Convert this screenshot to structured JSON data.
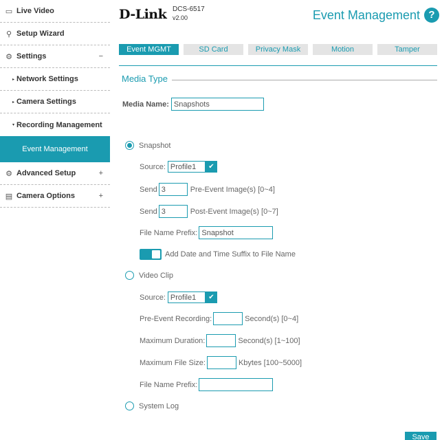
{
  "sidebar": {
    "live_video": "Live Video",
    "setup_wizard": "Setup Wizard",
    "settings": "Settings",
    "settings_toggle": "−",
    "network_settings": "Network Settings",
    "camera_settings": "Camera Settings",
    "recording_management": "Recording Management",
    "event_management": "Event Management",
    "advanced_setup": "Advanced Setup",
    "advanced_toggle": "+",
    "camera_options": "Camera Options",
    "camera_toggle": "+"
  },
  "header": {
    "logo": "D-Link",
    "model": "DCS-6517",
    "version": "v2.00",
    "title": "Event Management",
    "help": "?"
  },
  "tabs": [
    "Event MGMT",
    "SD Card",
    "Privacy Mask",
    "Motion",
    "Tamper"
  ],
  "section": {
    "title": "Media Type"
  },
  "form": {
    "media_name_label": "Media Name:",
    "media_name_value": "Snapshots",
    "snapshot_label": "Snapshot",
    "source_label": "Source:",
    "source_value": "Profile1",
    "send_label": "Send",
    "pre_count": "3",
    "pre_label": "Pre-Event Image(s) [0~4]",
    "post_count": "3",
    "post_label": "Post-Event Image(s) [0~7]",
    "prefix_label": "File Name Prefix:",
    "prefix_value": "Snapshot",
    "suffix_label": "Add Date and Time Suffix to File Name",
    "video_clip_label": "Video Clip",
    "clip_source_label": "Source:",
    "clip_source_value": "Profile1",
    "pre_event_rec_label": "Pre-Event Recording:",
    "pre_event_rec_unit": "Second(s) [0~4]",
    "max_duration_label": "Maximum Duration:",
    "max_duration_unit": "Second(s) [1~100]",
    "max_size_label": "Maximum File Size:",
    "max_size_unit": "Kbytes [100~5000]",
    "clip_prefix_label": "File Name Prefix:",
    "clip_prefix_value": "",
    "system_log_label": "System Log"
  },
  "save_label": "Save"
}
